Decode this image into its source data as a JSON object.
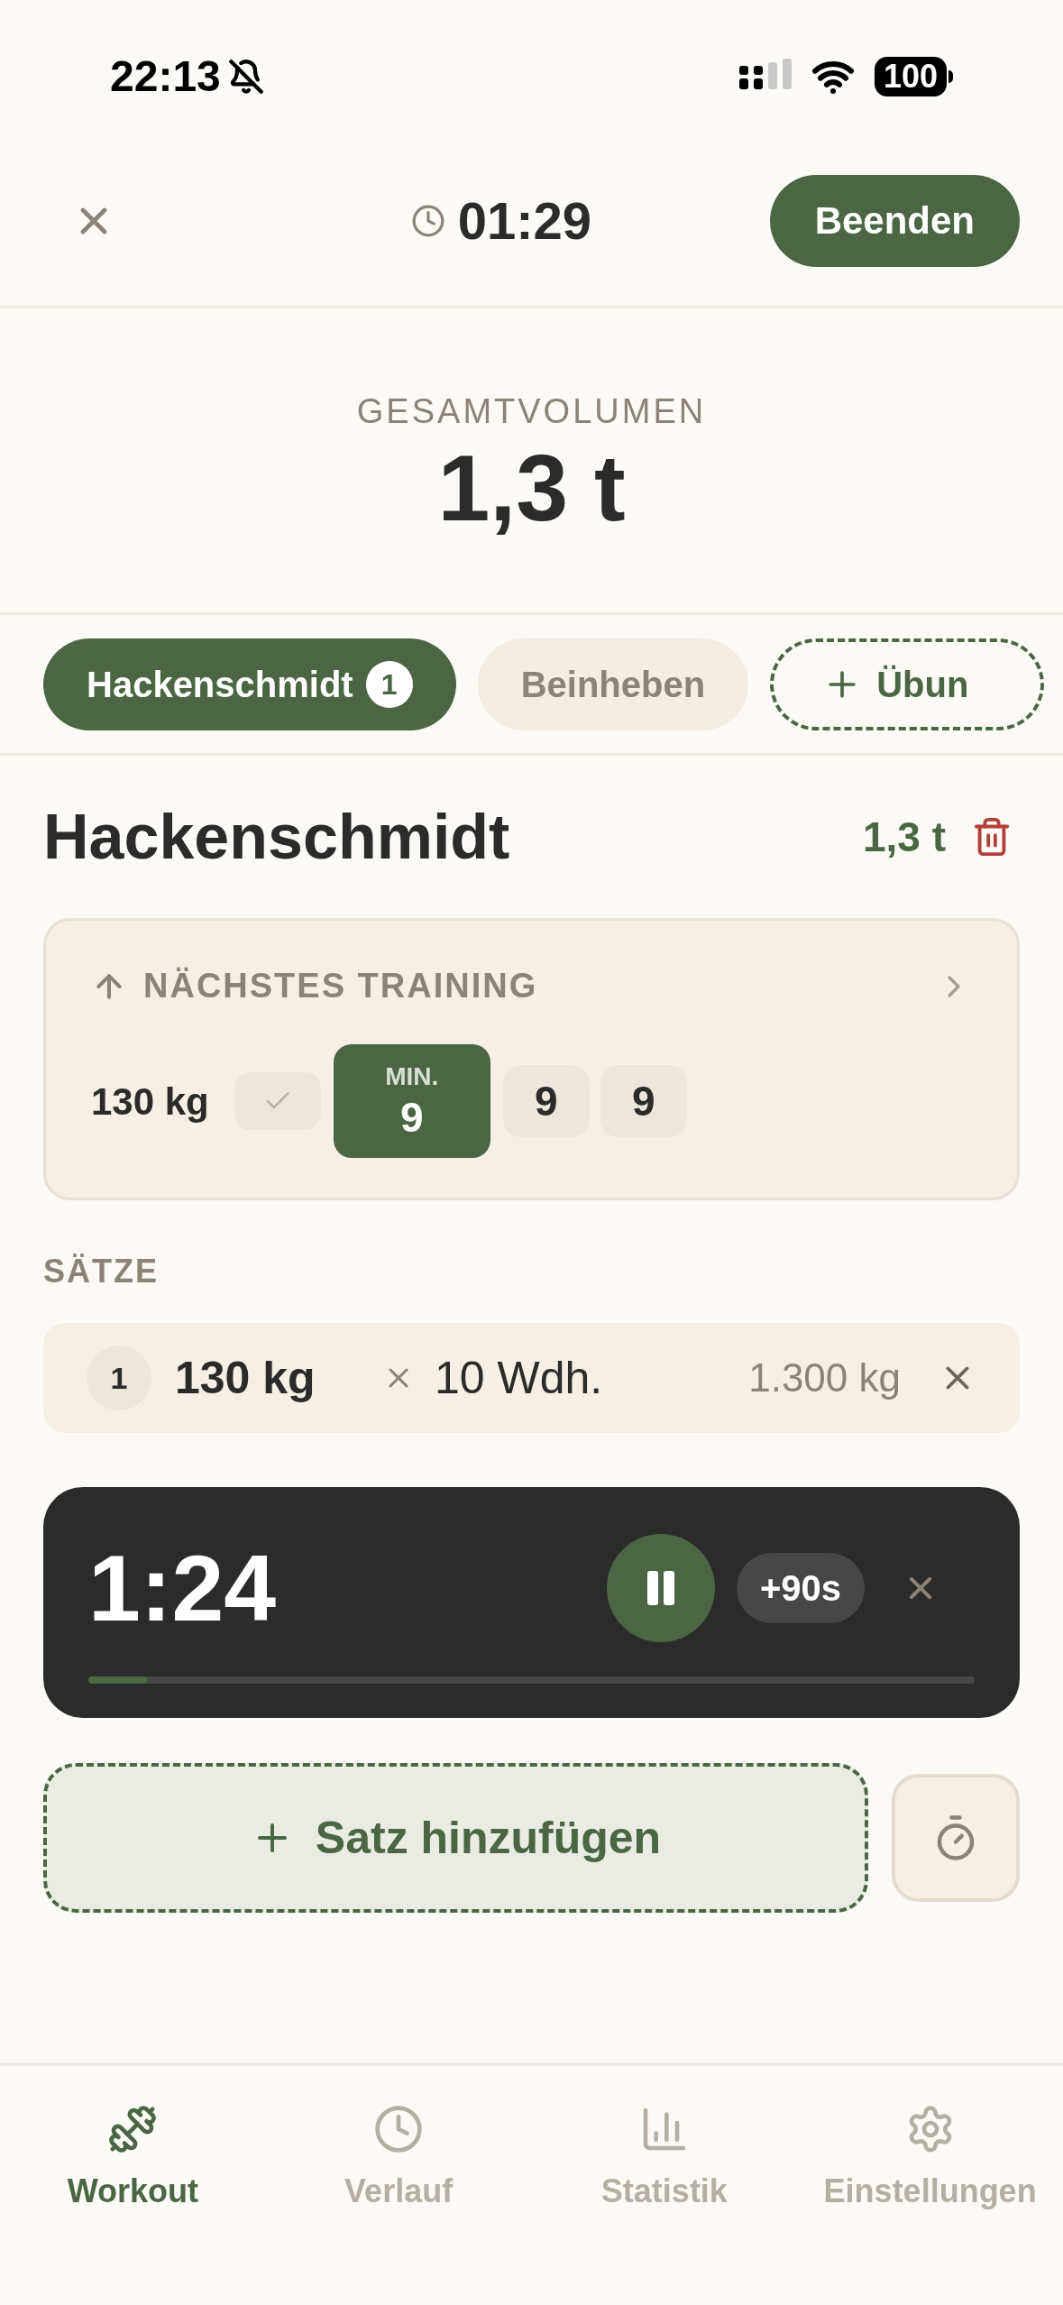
{
  "status_bar": {
    "time": "22:13",
    "battery": "100"
  },
  "header": {
    "elapsed": "01:29",
    "finish_button": "Beenden"
  },
  "total_volume": {
    "label": "GESAMTVOLUMEN",
    "value": "1,3 t"
  },
  "exercise_tabs": [
    {
      "label": "Hackenschmidt",
      "badge": "1",
      "selected": true
    },
    {
      "label": "Beinheben",
      "selected": false
    }
  ],
  "add_exercise": "Übun",
  "exercise": {
    "title": "Hackenschmidt",
    "volume": "1,3 t"
  },
  "next_training": {
    "title": "NÄCHSTES TRAINING",
    "weight": "130 kg",
    "cells": [
      {
        "kind": "check",
        "selected": false
      },
      {
        "kind": "reps",
        "label": "MIN.",
        "value": "9",
        "selected": true
      },
      {
        "kind": "reps",
        "value": "9",
        "selected": false
      },
      {
        "kind": "reps",
        "value": "9",
        "selected": false
      }
    ]
  },
  "sets_label": "SÄTZE",
  "sets": [
    {
      "number": "1",
      "weight": "130 kg",
      "reps": "10 Wdh.",
      "volume": "1.300 kg"
    }
  ],
  "rest_timer": {
    "time": "1:24",
    "add_button": "+90s",
    "level": 0.066
  },
  "add_set_button": "Satz hinzufügen",
  "nav": [
    {
      "kind": "workout",
      "label": "Workout",
      "selected": true
    },
    {
      "kind": "history",
      "label": "Verlauf",
      "selected": false
    },
    {
      "kind": "stats",
      "label": "Statistik",
      "selected": false
    },
    {
      "kind": "settings",
      "label": "Einstellungen",
      "selected": false
    }
  ]
}
